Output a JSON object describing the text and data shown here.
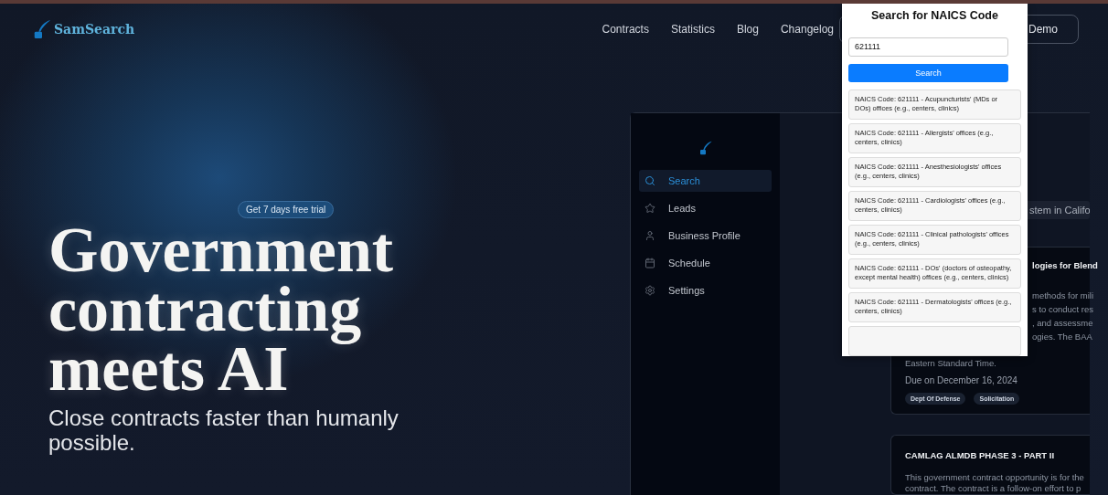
{
  "top_nav": {
    "logo": "SamSearch",
    "links": [
      "Contracts",
      "Statistics",
      "Blog",
      "Changelog"
    ],
    "cta": "Demo"
  },
  "hero": {
    "badge": "Get 7 days free trial",
    "headline": "Government contracting meets AI",
    "subtitle": "Close contracts faster than humanly possible."
  },
  "app_preview": {
    "sidebar": {
      "items": [
        {
          "label": "Search",
          "selected": true
        },
        {
          "label": "Leads",
          "selected": false
        },
        {
          "label": "Business Profile",
          "selected": false
        },
        {
          "label": "Schedule",
          "selected": false
        },
        {
          "label": "Settings",
          "selected": false
        }
      ]
    },
    "search_query": "stem in Califo",
    "cards": [
      {
        "title": "logies for Blend",
        "body_lines": [
          "methods for mili",
          "s to conduct res",
          ", and assessme",
          "ogies. The BAA"
        ],
        "last_line": "Eastern Standard Time.",
        "due": "Due on December 16, 2024",
        "tags": [
          "Dept Of Defense",
          "Solicitation"
        ]
      },
      {
        "title": "CAMLAG ALMDB PHASE 3 - PART II",
        "body_lines": [
          "This government contract opportunity is for the",
          "contract. The contract is a follow-on effort to p"
        ]
      }
    ]
  },
  "naics_popup": {
    "title": "Search for NAICS Code",
    "query": "621111",
    "button": "Search",
    "results": [
      "NAICS Code: 621111 - Acupuncturists' (MDs or DOs) offices (e.g., centers, clinics)",
      "NAICS Code: 621111 - Allergists' offices (e.g., centers, clinics)",
      "NAICS Code: 621111 - Anesthesiologists' offices (e.g., centers, clinics)",
      "NAICS Code: 621111 - Cardiologists' offices (e.g., centers, clinics)",
      "NAICS Code: 621111 - Clinical pathologists' offices (e.g., centers, clinics)",
      "NAICS Code: 621111 - DOs' (doctors of osteopathy, except mental health) offices (e.g., centers, clinics)",
      "NAICS Code: 621111 - Dermatologists' offices (e.g., centers, clinics)"
    ]
  }
}
